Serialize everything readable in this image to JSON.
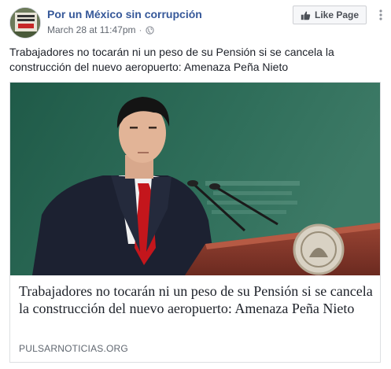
{
  "header": {
    "page_name": "Por un México sin corrupción",
    "timestamp": "March 28 at 11:47pm",
    "separator": "·",
    "privacy_icon": "globe-icon",
    "like_page_label": "Like Page",
    "like_icon": "thumbs-up-icon",
    "more_icon": "more-options-icon"
  },
  "post": {
    "text": "Trabajadores no tocarán ni un peso de su Pensión si se cancela la construcción del nuevo aeropuerto: Amenaza Peña Nieto"
  },
  "link": {
    "title": "Trabajadores no tocarán ni un peso de su Pensión si se cancela la construcción del nuevo aeropuerto: Amenaza Peña Nieto",
    "domain": "PULSARNOTICIAS.ORG"
  },
  "colors": {
    "link_blue": "#365899",
    "text": "#1d2129",
    "meta_gray": "#616770",
    "photo_background": "#2f6b56",
    "podium_red": "#8a3a2c"
  }
}
